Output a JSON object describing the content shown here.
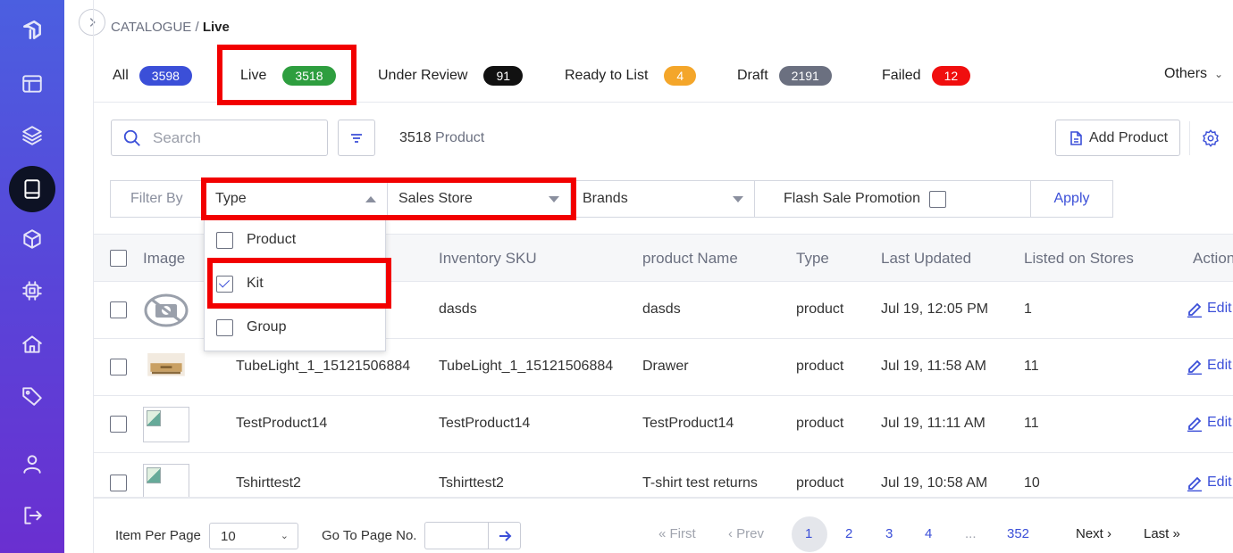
{
  "breadcrumb": {
    "root": "CATALOGUE",
    "separator": " / ",
    "current": "Live"
  },
  "tabs": [
    {
      "label": "All",
      "count": "3598",
      "color": "#3b4fd8"
    },
    {
      "label": "Live",
      "count": "3518",
      "color": "#2e9e3f"
    },
    {
      "label": "Under Review",
      "count": "91",
      "color": "#111111"
    },
    {
      "label": "Ready to List",
      "count": "4",
      "color": "#f4a62a"
    },
    {
      "label": "Draft",
      "count": "2191",
      "color": "#6b7080"
    },
    {
      "label": "Failed",
      "count": "12",
      "color": "#f00e0e"
    }
  ],
  "others_label": "Others",
  "search": {
    "placeholder": "Search"
  },
  "product_count": {
    "value": "3518",
    "unit": "Product"
  },
  "add_product_label": "Add Product",
  "filters": {
    "label": "Filter By",
    "type": "Type",
    "sales_store": "Sales Store",
    "brands": "Brands",
    "flash_sale": "Flash Sale Promotion",
    "apply": "Apply"
  },
  "type_dropdown": [
    {
      "label": "Product",
      "checked": false
    },
    {
      "label": "Kit",
      "checked": true
    },
    {
      "label": "Group",
      "checked": false
    }
  ],
  "table": {
    "headers": {
      "image": "Image",
      "sku": "Inventory SKU",
      "name": "product Name",
      "type": "Type",
      "updated": "Last Updated",
      "stores": "Listed on Stores",
      "action": "Action"
    },
    "rows": [
      {
        "title": "",
        "sku": "dasds",
        "name": "dasds",
        "type": "product",
        "updated": "Jul 19, 12:05 PM",
        "stores": "1",
        "edit": "Edit"
      },
      {
        "title": "TubeLight_1_15121506884",
        "sku": "TubeLight_1_15121506884",
        "name": "Drawer",
        "type": "product",
        "updated": "Jul 19, 11:58 AM",
        "stores": "11",
        "edit": "Edit"
      },
      {
        "title": "TestProduct14",
        "sku": "TestProduct14",
        "name": "TestProduct14",
        "type": "product",
        "updated": "Jul 19, 11:11 AM",
        "stores": "11",
        "edit": "Edit"
      },
      {
        "title": "Tshirttest2",
        "sku": "Tshirttest2",
        "name": "T-shirt test returns",
        "type": "product",
        "updated": "Jul 19, 10:58 AM",
        "stores": "10",
        "edit": "Edit"
      }
    ]
  },
  "footer": {
    "per_page_label": "Item Per Page",
    "per_page_value": "10",
    "goto_label": "Go To Page No.",
    "first": "First",
    "prev": "Prev",
    "pages": [
      "1",
      "2",
      "3",
      "4"
    ],
    "ellipsis": "...",
    "last_page": "352",
    "next": "Next",
    "last": "Last"
  }
}
